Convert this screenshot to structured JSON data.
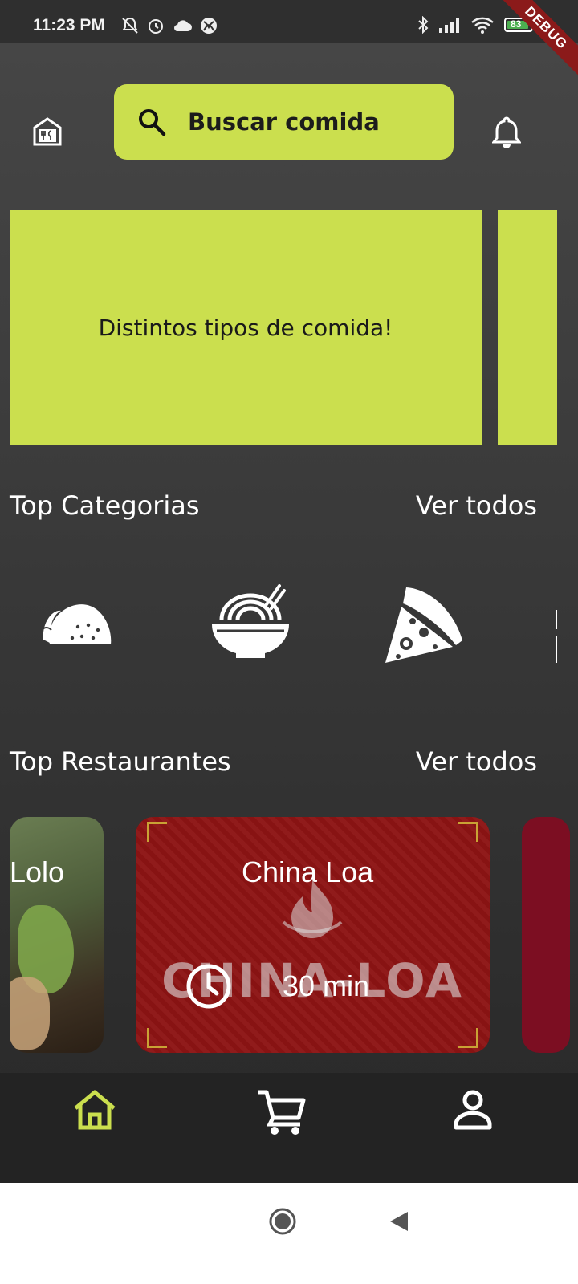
{
  "status_bar": {
    "time": "11:23 PM",
    "battery_level": "83",
    "left_icons": [
      "mute-icon",
      "alarm-icon",
      "cloud-icon",
      "xbox-icon"
    ],
    "right_icons": [
      "bluetooth-icon",
      "signal-icon",
      "wifi-icon",
      "battery-icon",
      "charging-icon"
    ]
  },
  "debug_banner": "DEBUG",
  "header": {
    "logo_icon": "restaurant-home-icon",
    "search_placeholder": "Buscar comida",
    "search_icon": "search-icon",
    "notifications_icon": "bell-icon"
  },
  "carousel": {
    "banners": [
      {
        "text": "Distintos tipos de comida!"
      }
    ],
    "color": "#cbdf4e"
  },
  "top_categories": {
    "title": "Top Categorias",
    "link": "Ver todos",
    "items": [
      {
        "icon": "taco-icon"
      },
      {
        "icon": "ramen-bowl-icon"
      },
      {
        "icon": "pizza-slice-icon"
      }
    ]
  },
  "top_restaurants": {
    "title": "Top Restaurantes",
    "link": "Ver todos",
    "items": [
      {
        "name": "Lolo"
      },
      {
        "name": "China Loa",
        "logo_text": "CHINA-LOA",
        "time": "30 min"
      }
    ]
  },
  "bottom_nav": {
    "items": [
      {
        "icon": "home-icon",
        "active": true
      },
      {
        "icon": "cart-icon",
        "active": false
      },
      {
        "icon": "profile-icon",
        "active": false
      }
    ],
    "active_color": "#cbdf4e"
  },
  "system_nav": [
    "home-circle-icon",
    "back-triangle-icon"
  ]
}
